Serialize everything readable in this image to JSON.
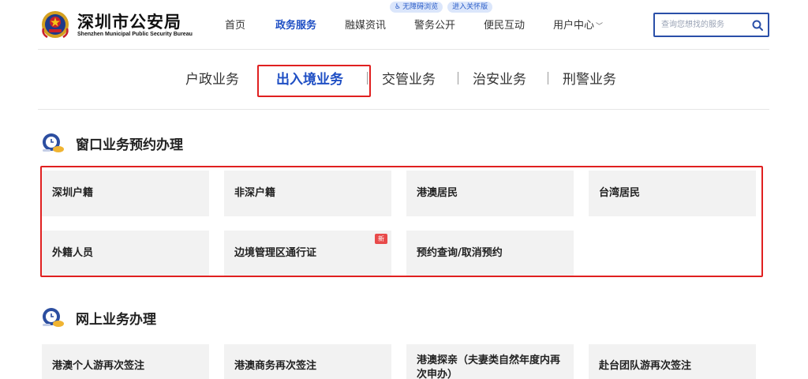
{
  "header": {
    "title": "深圳市公安局",
    "subtitle": "Shenzhen Municipal Public Security Bureau",
    "badges": {
      "accessibility": "无障碍浏览",
      "care": "进入关怀版"
    },
    "nav": {
      "home": "首页",
      "gov_services": "政务服务",
      "media": "融媒资讯",
      "police_open": "警务公开",
      "interaction": "便民互动",
      "user_center": "用户中心"
    },
    "search": {
      "placeholder": "查询您想找的服务"
    }
  },
  "tabs": {
    "household": "户政业务",
    "exit_entry": "出入境业务",
    "traffic": "交管业务",
    "public_order": "治安业务",
    "criminal": "刑警业务"
  },
  "sections": {
    "window": {
      "title": "窗口业务预约办理",
      "items": {
        "shenzhen_hukou": "深圳户籍",
        "non_shenzhen_hukou": "非深户籍",
        "hk_macau": "港澳居民",
        "taiwan": "台湾居民",
        "foreigners": "外籍人员",
        "border_pass": "边境管理区通行证",
        "border_pass_badge": "新",
        "appointment_query": "预约查询/取消预约"
      }
    },
    "online": {
      "title": "网上业务办理",
      "items": {
        "hk_individual": "港澳个人游再次签注",
        "hk_business": "港澳商务再次签注",
        "hk_family": "港澳探亲（夫妻类自然年度内再次申办）",
        "taiwan_group": "赴台团队游再次签注"
      }
    }
  },
  "colors": {
    "accent": "#1f4fc4",
    "highlight": "#e02020",
    "card_bg": "#f2f2f2",
    "new_badge": "#e84a4a"
  },
  "icons": {
    "logo": "police-emblem",
    "search": "search-icon",
    "section": "clock-hand-icon",
    "accessibility": "wheelchair-icon"
  }
}
